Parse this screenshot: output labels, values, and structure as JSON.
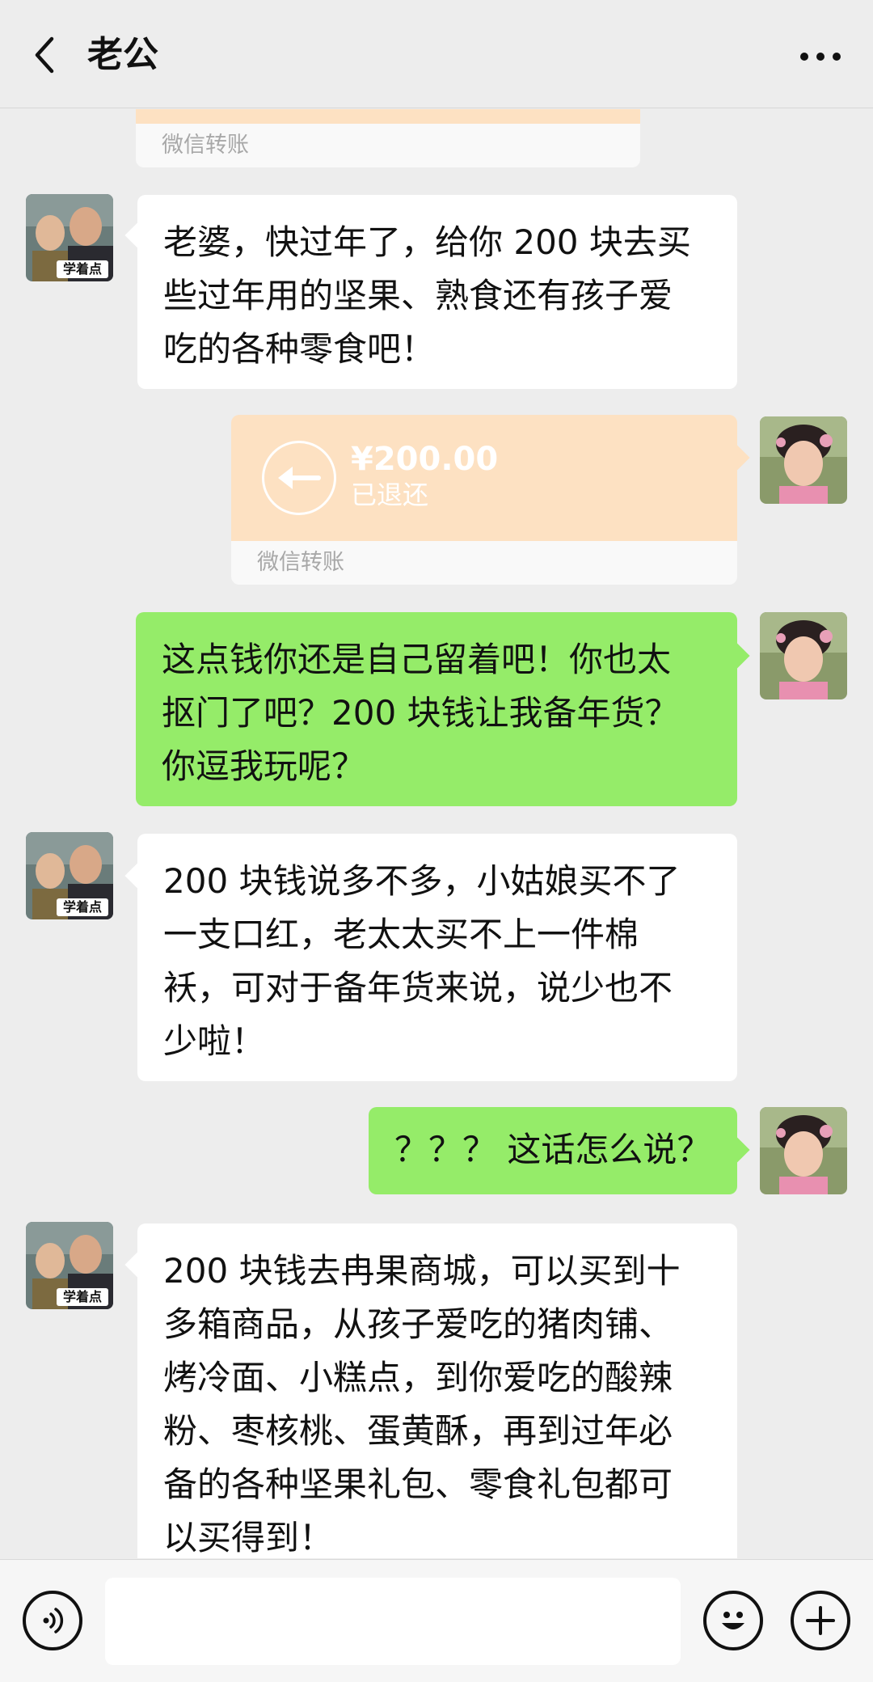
{
  "header": {
    "title": "老公",
    "back_icon": "chevron-left-icon",
    "more_icon": "more-dots-icon"
  },
  "messages": {
    "partial_transfer": {
      "label": "微信转账"
    },
    "m1": {
      "sender": "老公",
      "direction": "incoming",
      "text": "老婆，快过年了，给你 200 块去买\n些过年用的坚果、熟食还有孩子爱\n吃的各种零食吧！"
    },
    "m2": {
      "sender": "me",
      "direction": "outgoing",
      "type": "transfer",
      "amount": "¥200.00",
      "status": "已退还",
      "label": "微信转账",
      "icon": "return-arrow-icon"
    },
    "m3": {
      "sender": "me",
      "direction": "outgoing",
      "text": "这点钱你还是自己留着吧！你也太\n抠门了吧？200 块钱让我备年货？\n你逗我玩呢？"
    },
    "m4": {
      "sender": "老公",
      "direction": "incoming",
      "text": "200 块钱说多不多，小姑娘买不了\n一支口红，老太太买不上一件棉\n袄，可对于备年货来说，说少也不\n少啦！"
    },
    "m5": {
      "sender": "me",
      "direction": "outgoing",
      "text": "？？？ 这话怎么说？"
    },
    "m6": {
      "sender": "老公",
      "direction": "incoming",
      "text": "200 块钱去冉果商城，可以买到十\n多箱商品，从孩子爱吃的猪肉铺、\n烤冷面、小糕点，到你爱吃的酸辣\n粉、枣核桃、蛋黄酥，再到过年必\n备的各种坚果礼包、零食礼包都可\n以买得到！"
    }
  },
  "avatars": {
    "husband_badge": "学着点"
  },
  "input_bar": {
    "voice_icon": "voice-icon",
    "input_value": "",
    "emoji_icon": "emoji-icon",
    "plus_icon": "plus-icon"
  },
  "colors": {
    "background": "#ededed",
    "outgoing_bubble": "#95ec69",
    "incoming_bubble": "#ffffff",
    "transfer_card": "#fde1c2"
  }
}
